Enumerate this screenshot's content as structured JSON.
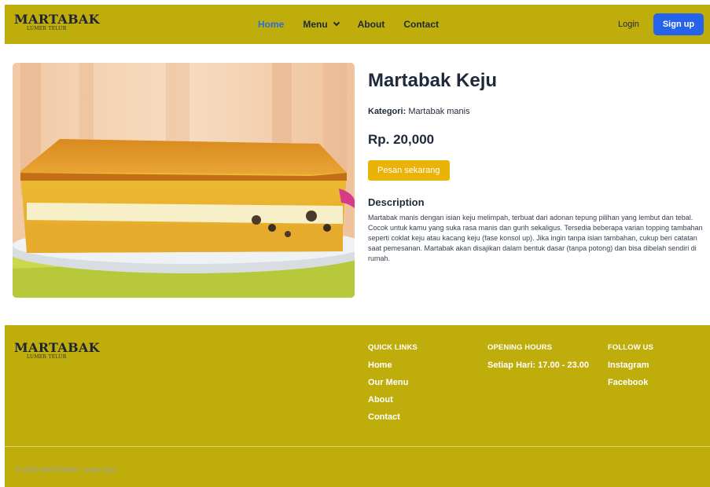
{
  "brand": {
    "name": "MARTABAK",
    "tagline": "LUMER TELUR"
  },
  "nav": {
    "items": [
      {
        "label": "Home",
        "active": true
      },
      {
        "label": "Menu",
        "dropdown": true
      },
      {
        "label": "About"
      },
      {
        "label": "Contact"
      }
    ],
    "login_label": "Login",
    "signup_label": "Sign up"
  },
  "product": {
    "image_alt": "Martabak Keju",
    "title": "Martabak Keju",
    "category_label": "Kategori:",
    "category_value": "Martabak manis",
    "price": "Rp. 20,000",
    "order_label": "Pesan sekarang",
    "description_heading": "Description",
    "description": "Martabak manis dengan isian keju melimpah, terbuat dari adonan tepung pilihan yang lembut dan tebal. Cocok untuk kamu yang suka rasa manis dan gurih sekaligus. Tersedia beberapa varian topping tambahan seperti coklat keju atau kacang keju (fase konsol up). Jika ingin tanpa isian tambahan, cukup beri catatan saat pemesanan. Martabak akan disajikan dalam bentuk dasar (tanpa potong) dan bisa dibelah sendiri di rumah."
  },
  "footer": {
    "quick_links": {
      "heading": "QUICK LINKS",
      "items": [
        "Home",
        "Our Menu",
        "About",
        "Contact"
      ]
    },
    "opening_hours": {
      "heading": "OPENING HOURS",
      "text": "Setiap Hari: 17.00 - 23.00"
    },
    "follow_us": {
      "heading": "FOLLOW US",
      "items": [
        "Instagram",
        "Facebook"
      ]
    },
    "copyright": "© 2025 MARTABAK. lumer telur"
  },
  "colors": {
    "header_bg": "#bfad0c",
    "accent_button": "#eab308",
    "signup_button": "#2563eb",
    "active_nav": "#2d6fd8"
  }
}
